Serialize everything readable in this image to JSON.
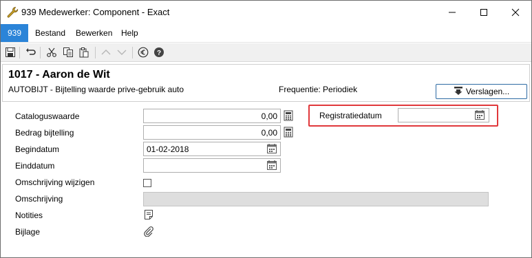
{
  "window": {
    "title": "939 Medewerker: Component - Exact",
    "minimize_glyph": "—",
    "close_glyph": "✕"
  },
  "menubar": {
    "company": "939",
    "items": [
      "Bestand",
      "Bewerken",
      "Help"
    ]
  },
  "toolbar": {
    "icons": [
      "save-icon",
      "undo-icon",
      "cut-icon",
      "copy-icon",
      "paste-icon",
      "arrow-up-icon",
      "arrow-down-icon",
      "euro-icon",
      "help-icon"
    ]
  },
  "header": {
    "employee": "1017 - Aaron de Wit",
    "component": "AUTOBIJT - Bijtelling waarde prive-gebruik auto",
    "frequency": "Frequentie: Periodiek",
    "reports_button": "Verslagen..."
  },
  "form": {
    "catalog_value": {
      "label": "Cataloguswaarde",
      "value": "0,00"
    },
    "addition_amount": {
      "label": "Bedrag bijtelling",
      "value": "0,00"
    },
    "start_date": {
      "label": "Begindatum",
      "value": "01-02-2018"
    },
    "end_date": {
      "label": "Einddatum",
      "value": ""
    },
    "edit_description": {
      "label": "Omschrijving wijzigen",
      "checked": false
    },
    "description": {
      "label": "Omschrijving",
      "value": ""
    },
    "notes": {
      "label": "Notities"
    },
    "attachment": {
      "label": "Bijlage"
    },
    "registration_date": {
      "label": "Registratiedatum",
      "value": ""
    }
  },
  "colors": {
    "accent": "#2b84d8",
    "highlight": "#e0373a",
    "toolbar_bg": "#f0f0f0"
  }
}
